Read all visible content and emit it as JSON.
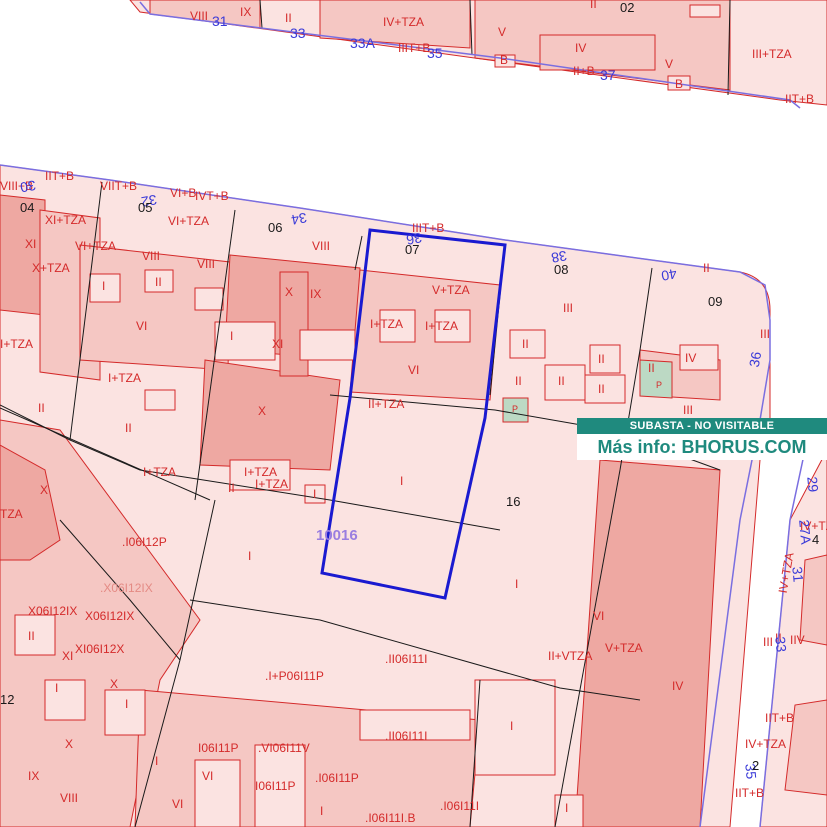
{
  "map": {
    "colors": {
      "fill_light": "#fbe3e1",
      "fill_mid": "#f5c7c3",
      "fill_dark": "#eea8a2",
      "line_red": "#d42a2a",
      "line_blue": "#1a1ad0",
      "street_line": "#7a6ee0",
      "green_plot": "#bcd9c4"
    },
    "parcel_numbers": [
      "04",
      "05",
      "06",
      "07",
      "08",
      "09",
      "16",
      "02",
      "12"
    ],
    "selected_parcel_ref": "10016",
    "labels": {
      "l1": "VIII",
      "l2": "IX",
      "l3": "II",
      "l4": "IV+TZA",
      "l5": "V",
      "l6": "II",
      "l7": "IV",
      "l8": "V",
      "l9": "III+TZA",
      "l10": "IIIT+B",
      "l11": "B",
      "l12": "II+B",
      "l13": "IIT+B",
      "l14": "B",
      "l15": "IIT+B",
      "l16": "VIIT+B",
      "l17": "VIII+B",
      "l18": "IVT+B",
      "l19": "VI+B",
      "l20": "XI+TZA",
      "l21": "VI+TZA",
      "l22": "VI+TZA",
      "l23": "IIIT+B",
      "l24": "XI",
      "l25": "X+TZA",
      "l26": "VIII",
      "l27": "VIII",
      "l28": "VIII",
      "l29": "X",
      "l30": "IX",
      "l31": "V+TZA",
      "l32": "III",
      "l33": "I",
      "l34": "II",
      "l35": "I+TZA",
      "l36": "I+TZA",
      "l37": "XI",
      "l38": "I",
      "l39": "VI",
      "l40": "VI",
      "l41": "I+TZA",
      "l42": "II",
      "l43": "II",
      "l44": "II",
      "l45": "IV",
      "l46": "II",
      "l47": "II",
      "l48": "II",
      "l49": "III",
      "l50": "P",
      "l51": "P",
      "l52": "X",
      "l53": "II+TZA",
      "l54": "I+TZA",
      "l55": "I+TZA",
      "l56": "I+TZA",
      "l57": "I+TZA",
      "l58": "II",
      "l59": "II",
      "l60": "II",
      "l61": "I",
      "l62": ".I06I12P",
      "l63": "I",
      "l64": "TZA",
      "l65": "X",
      "l66": ".X06I12IX",
      "l67": "X06I12IX",
      "l68": "X06I12IX",
      "l69": "XI06I12X",
      "l70": "XI",
      "l71": "II",
      "l72": "I",
      "l73": "X",
      "l74": "I",
      "l75": "X",
      "l76": "IX",
      "l77": "VIII",
      "l78": "VI",
      "l79": ".II06I11I",
      ".l80": "",
      "l80": ".I+P06I11P",
      "l81": ".II06I11I",
      "l82": "I",
      "l83": "I06I11P",
      "l84": ".VI06I11V",
      "l85": "VI",
      "l86": "I06I11P",
      "l87": ".I06I11P",
      "l88": ".I06I11I",
      "l89": ".I06I11I.B",
      "l90": "I",
      "l91": "I",
      "l92": "I",
      "l93": "I",
      "l94": "II+VTZA",
      "l95": "V+TZA",
      "l96": "VI",
      "l97": "IV",
      "l98": "I",
      "l99": "II",
      "l100": "III",
      "l101": "IV+TZA",
      "l102": "IV+TZA",
      "l103": "IIT+B",
      "l104": "IV+TZA",
      "l105": "IIT+B",
      "l106": "III",
      "l107": "IIV",
      "l108": "II+TZA",
      "l109": "I+TZA",
      "l110": "I+TZA",
      "l111": "II"
    },
    "streets": {
      "s31": "31",
      "s33": "33",
      "s33a": "33A",
      "s35": "35",
      "s37": "37",
      "s30": "30",
      "s32": "32",
      "s34": "34",
      "s36a": "36",
      "s36b": "36",
      "s40": "40",
      "s38": "38",
      "s29": "29",
      "s27a": "27A",
      "s31b": "31",
      "s33b": "33",
      "s35b": "35",
      "s4": "4",
      "s2": "2"
    }
  },
  "banner": {
    "line1": "SUBASTA - NO VISITABLE",
    "line2": "Más info: BHORUS.COM",
    "accent": "#1f8a7e"
  }
}
